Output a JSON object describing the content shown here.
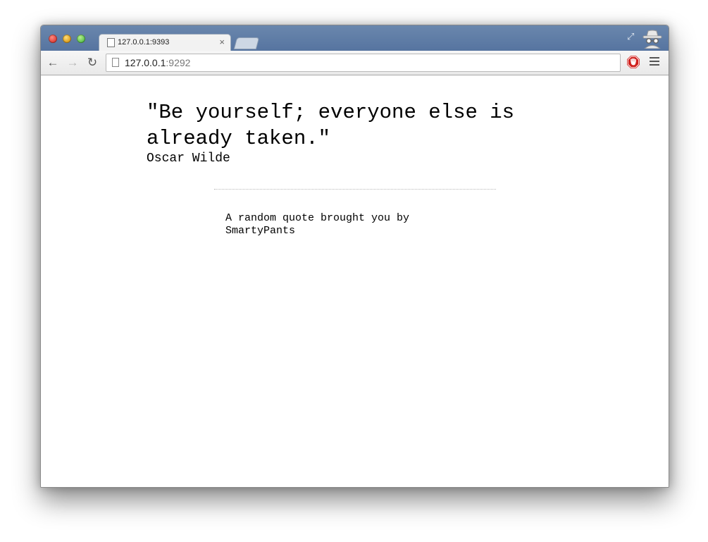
{
  "browser": {
    "tab": {
      "title": "127.0.0.1:9393",
      "close_label": "×"
    },
    "address_bar": {
      "host": "127.0.0.1",
      "port": ":9292"
    },
    "icons": {
      "back": "back-arrow-icon",
      "forward": "forward-arrow-icon",
      "reload": "reload-icon",
      "page": "page-icon",
      "stop": "stop-icon",
      "menu": "hamburger-menu-icon",
      "fullscreen": "fullscreen-icon",
      "incognito": "incognito-icon"
    },
    "colors": {
      "titlebar": "#5e7ba5",
      "stop_red": "#d0201d"
    }
  },
  "page": {
    "quote": "\"Be yourself; everyone else is already taken.\"",
    "author": "Oscar Wilde",
    "footer": "A random quote brought you by SmartyPants"
  }
}
